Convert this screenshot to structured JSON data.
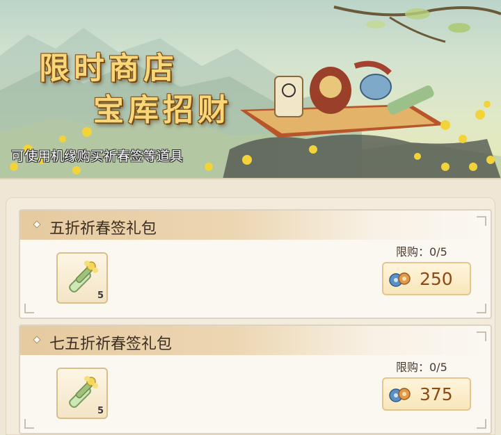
{
  "banner": {
    "title_line1": "限时商店",
    "title_line2": "宝库招财",
    "subtitle": "可使用机缘购买祈春签等道具"
  },
  "items": [
    {
      "title": "五折祈春签礼包",
      "limit": "限购：0/5",
      "price": "250",
      "count": "5",
      "icon": "spring-lot-bundle-icon",
      "currency_icon": "jiyuan-coin-icon"
    },
    {
      "title": "七五折祈春签礼包",
      "limit": "限购：0/5",
      "price": "375",
      "count": "5",
      "icon": "spring-lot-bundle-icon",
      "currency_icon": "jiyuan-coin-icon"
    }
  ],
  "colors": {
    "title_gold": "#f7d77a",
    "price_brown": "#8a4a16",
    "header_band": "#e6caa0"
  }
}
